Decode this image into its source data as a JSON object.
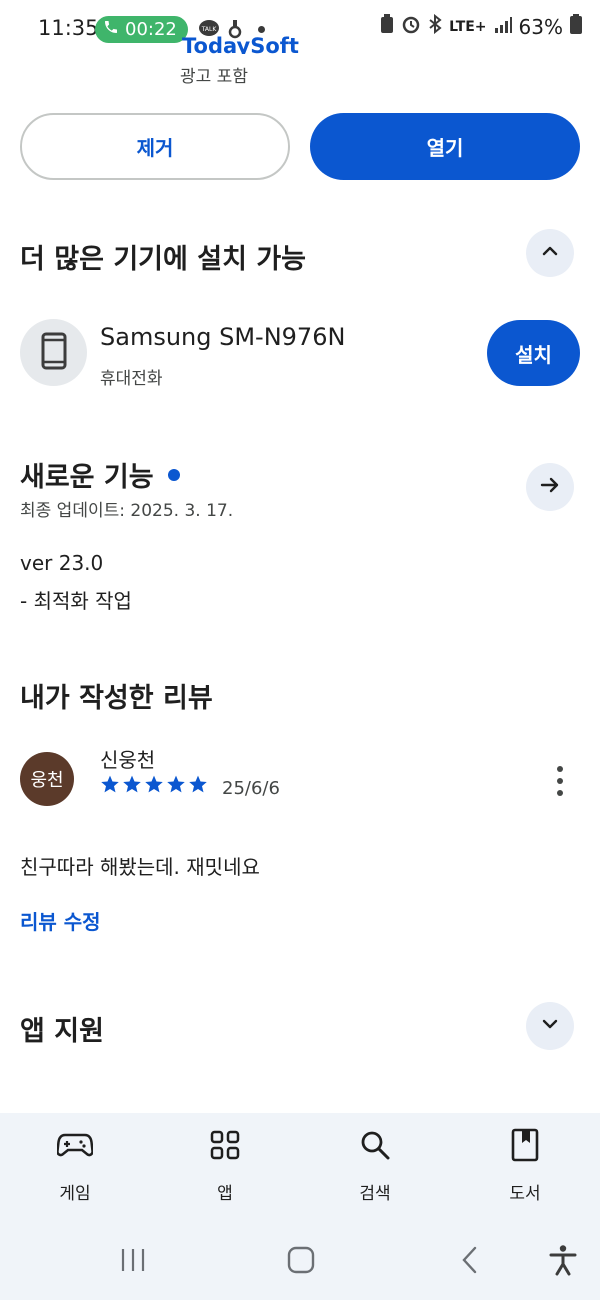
{
  "status_bar": {
    "time": "11:35",
    "call_duration": "00:22",
    "network": "LTE+",
    "battery": "63%",
    "icons": [
      "phone-icon",
      "kakaotalk-icon",
      "notification-icon",
      "dot-icon",
      "battery-saver-icon",
      "alarm-icon",
      "bluetooth-icon",
      "signal-icon",
      "battery-icon"
    ]
  },
  "app": {
    "developer": "TodaySoft",
    "ads_note": "광고 포함"
  },
  "actions": {
    "uninstall_label": "제거",
    "open_label": "열기"
  },
  "more_devices": {
    "title": "더 많은 기기에 설치 가능",
    "toggle_icon": "chevron-up-icon",
    "device": {
      "name": "Samsung SM-N976N",
      "type": "휴대전화",
      "icon": "phone-device-icon",
      "install_label": "설치"
    }
  },
  "whats_new": {
    "title": "새로운 기능",
    "updated": "최종 업데이트: 2025. 3. 17.",
    "version": "ver 23.0",
    "notes": "- 최적화 작업",
    "arrow_icon": "arrow-right-icon"
  },
  "my_review": {
    "title": "내가 작성한 리뷰",
    "avatar_text": "웅천",
    "reviewer": "신웅천",
    "rating": 5,
    "date": "25/6/6",
    "text": "친구따라 해봤는데. 재밋네요",
    "edit_label": "리뷰 수정"
  },
  "app_support": {
    "title": "앱 지원",
    "toggle_icon": "chevron-down-icon"
  },
  "bottom_nav": {
    "items": [
      {
        "label": "게임",
        "icon": "gamepad-icon"
      },
      {
        "label": "앱",
        "icon": "apps-grid-icon"
      },
      {
        "label": "검색",
        "icon": "search-icon"
      },
      {
        "label": "도서",
        "icon": "book-icon"
      }
    ]
  },
  "colors": {
    "accent": "#0b57d0",
    "call_green": "#3fb56b",
    "nav_background": "#f0f4f9",
    "avatar_brown": "#5b3a2a"
  }
}
